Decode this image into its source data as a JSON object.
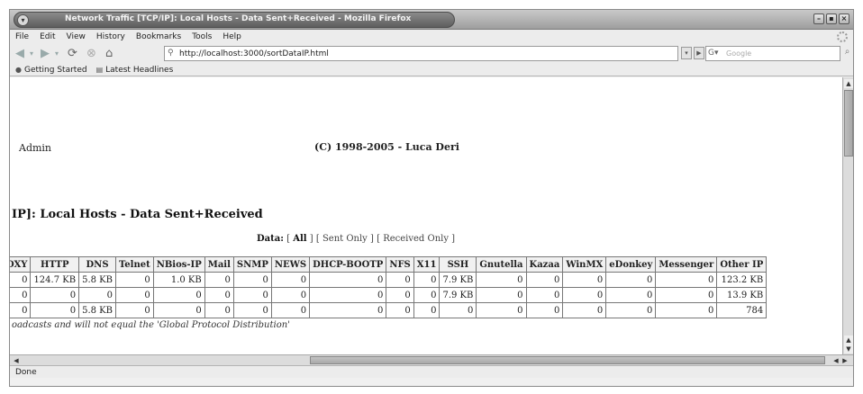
{
  "window": {
    "title": "Network Traffic [TCP/IP]: Local Hosts - Data Sent+Received - Mozilla Firefox",
    "menu_button": "▾",
    "controls": [
      "–",
      "▪",
      "×"
    ]
  },
  "menubar": [
    "File",
    "Edit",
    "View",
    "History",
    "Bookmarks",
    "Tools",
    "Help"
  ],
  "navbar": {
    "url": "http://localhost:3000/sortDataIP.html",
    "search_placeholder": "Google"
  },
  "bookmarks": [
    {
      "icon": "firefox-icon",
      "label": "Getting Started"
    },
    {
      "icon": "rss-feed-icon",
      "label": "Latest Headlines"
    }
  ],
  "content": {
    "admin": "Admin",
    "copyright": "(C) 1998-2005 - Luca Deri",
    "heading": "IP]: Local Hosts - Data Sent+Received",
    "filter": {
      "label": "Data:",
      "all": "All",
      "sent": "Sent Only",
      "received": "Received Only"
    },
    "table": {
      "headers": [
        "OXY",
        "HTTP",
        "DNS",
        "Telnet",
        "NBios-IP",
        "Mail",
        "SNMP",
        "NEWS",
        "DHCP-BOOTP",
        "NFS",
        "X11",
        "SSH",
        "Gnutella",
        "Kazaa",
        "WinMX",
        "eDonkey",
        "Messenger",
        "Other IP"
      ],
      "rows": [
        [
          "0",
          "124.7 KB",
          "5.8 KB",
          "0",
          "1.0 KB",
          "0",
          "0",
          "0",
          "0",
          "0",
          "0",
          "7.9 KB",
          "0",
          "0",
          "0",
          "0",
          "0",
          "123.2 KB"
        ],
        [
          "0",
          "0",
          "0",
          "0",
          "0",
          "0",
          "0",
          "0",
          "0",
          "0",
          "0",
          "7.9 KB",
          "0",
          "0",
          "0",
          "0",
          "0",
          "13.9 KB"
        ],
        [
          "0",
          "0",
          "5.8 KB",
          "0",
          "0",
          "0",
          "0",
          "0",
          "0",
          "0",
          "0",
          "0",
          "0",
          "0",
          "0",
          "0",
          "0",
          "784"
        ]
      ]
    },
    "footnote": "oadcasts and will not equal the 'Global Protocol Distribution'"
  },
  "status": "Done"
}
